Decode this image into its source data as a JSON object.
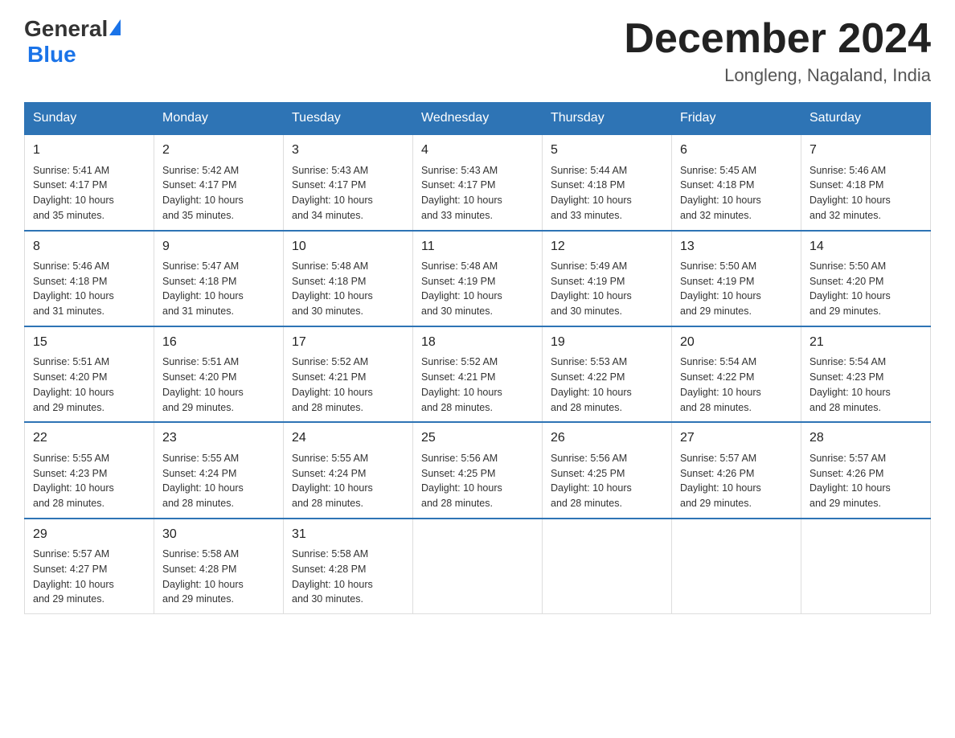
{
  "logo": {
    "general": "General",
    "blue": "Blue"
  },
  "title": "December 2024",
  "location": "Longleng, Nagaland, India",
  "days_of_week": [
    "Sunday",
    "Monday",
    "Tuesday",
    "Wednesday",
    "Thursday",
    "Friday",
    "Saturday"
  ],
  "weeks": [
    [
      {
        "day": "1",
        "sunrise": "5:41 AM",
        "sunset": "4:17 PM",
        "daylight": "10 hours and 35 minutes."
      },
      {
        "day": "2",
        "sunrise": "5:42 AM",
        "sunset": "4:17 PM",
        "daylight": "10 hours and 35 minutes."
      },
      {
        "day": "3",
        "sunrise": "5:43 AM",
        "sunset": "4:17 PM",
        "daylight": "10 hours and 34 minutes."
      },
      {
        "day": "4",
        "sunrise": "5:43 AM",
        "sunset": "4:17 PM",
        "daylight": "10 hours and 33 minutes."
      },
      {
        "day": "5",
        "sunrise": "5:44 AM",
        "sunset": "4:18 PM",
        "daylight": "10 hours and 33 minutes."
      },
      {
        "day": "6",
        "sunrise": "5:45 AM",
        "sunset": "4:18 PM",
        "daylight": "10 hours and 32 minutes."
      },
      {
        "day": "7",
        "sunrise": "5:46 AM",
        "sunset": "4:18 PM",
        "daylight": "10 hours and 32 minutes."
      }
    ],
    [
      {
        "day": "8",
        "sunrise": "5:46 AM",
        "sunset": "4:18 PM",
        "daylight": "10 hours and 31 minutes."
      },
      {
        "day": "9",
        "sunrise": "5:47 AM",
        "sunset": "4:18 PM",
        "daylight": "10 hours and 31 minutes."
      },
      {
        "day": "10",
        "sunrise": "5:48 AM",
        "sunset": "4:18 PM",
        "daylight": "10 hours and 30 minutes."
      },
      {
        "day": "11",
        "sunrise": "5:48 AM",
        "sunset": "4:19 PM",
        "daylight": "10 hours and 30 minutes."
      },
      {
        "day": "12",
        "sunrise": "5:49 AM",
        "sunset": "4:19 PM",
        "daylight": "10 hours and 30 minutes."
      },
      {
        "day": "13",
        "sunrise": "5:50 AM",
        "sunset": "4:19 PM",
        "daylight": "10 hours and 29 minutes."
      },
      {
        "day": "14",
        "sunrise": "5:50 AM",
        "sunset": "4:20 PM",
        "daylight": "10 hours and 29 minutes."
      }
    ],
    [
      {
        "day": "15",
        "sunrise": "5:51 AM",
        "sunset": "4:20 PM",
        "daylight": "10 hours and 29 minutes."
      },
      {
        "day": "16",
        "sunrise": "5:51 AM",
        "sunset": "4:20 PM",
        "daylight": "10 hours and 29 minutes."
      },
      {
        "day": "17",
        "sunrise": "5:52 AM",
        "sunset": "4:21 PM",
        "daylight": "10 hours and 28 minutes."
      },
      {
        "day": "18",
        "sunrise": "5:52 AM",
        "sunset": "4:21 PM",
        "daylight": "10 hours and 28 minutes."
      },
      {
        "day": "19",
        "sunrise": "5:53 AM",
        "sunset": "4:22 PM",
        "daylight": "10 hours and 28 minutes."
      },
      {
        "day": "20",
        "sunrise": "5:54 AM",
        "sunset": "4:22 PM",
        "daylight": "10 hours and 28 minutes."
      },
      {
        "day": "21",
        "sunrise": "5:54 AM",
        "sunset": "4:23 PM",
        "daylight": "10 hours and 28 minutes."
      }
    ],
    [
      {
        "day": "22",
        "sunrise": "5:55 AM",
        "sunset": "4:23 PM",
        "daylight": "10 hours and 28 minutes."
      },
      {
        "day": "23",
        "sunrise": "5:55 AM",
        "sunset": "4:24 PM",
        "daylight": "10 hours and 28 minutes."
      },
      {
        "day": "24",
        "sunrise": "5:55 AM",
        "sunset": "4:24 PM",
        "daylight": "10 hours and 28 minutes."
      },
      {
        "day": "25",
        "sunrise": "5:56 AM",
        "sunset": "4:25 PM",
        "daylight": "10 hours and 28 minutes."
      },
      {
        "day": "26",
        "sunrise": "5:56 AM",
        "sunset": "4:25 PM",
        "daylight": "10 hours and 28 minutes."
      },
      {
        "day": "27",
        "sunrise": "5:57 AM",
        "sunset": "4:26 PM",
        "daylight": "10 hours and 29 minutes."
      },
      {
        "day": "28",
        "sunrise": "5:57 AM",
        "sunset": "4:26 PM",
        "daylight": "10 hours and 29 minutes."
      }
    ],
    [
      {
        "day": "29",
        "sunrise": "5:57 AM",
        "sunset": "4:27 PM",
        "daylight": "10 hours and 29 minutes."
      },
      {
        "day": "30",
        "sunrise": "5:58 AM",
        "sunset": "4:28 PM",
        "daylight": "10 hours and 29 minutes."
      },
      {
        "day": "31",
        "sunrise": "5:58 AM",
        "sunset": "4:28 PM",
        "daylight": "10 hours and 30 minutes."
      },
      null,
      null,
      null,
      null
    ]
  ],
  "labels": {
    "sunrise": "Sunrise:",
    "sunset": "Sunset:",
    "daylight": "Daylight:"
  }
}
